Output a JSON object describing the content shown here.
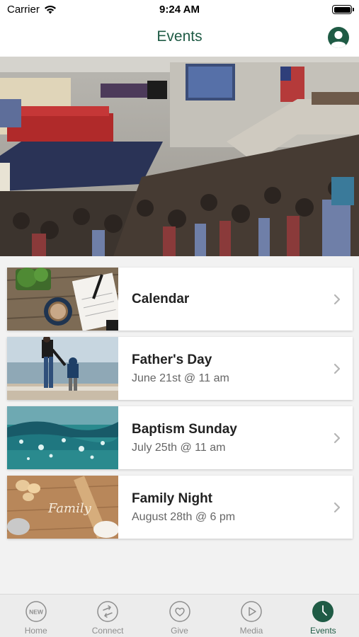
{
  "status_bar": {
    "carrier": "Carrier",
    "time": "9:24 AM",
    "wifi_icon": "wifi-icon",
    "battery_icon": "battery-icon"
  },
  "nav": {
    "title": "Events",
    "profile_icon": "user-profile-icon"
  },
  "hero": {
    "image": "church-congregation-photo"
  },
  "events": [
    {
      "title": "Calendar",
      "subtitle": "",
      "thumb": "notebook-coffee-photo"
    },
    {
      "title": "Father's Day",
      "subtitle": "June 21st @ 11 am",
      "thumb": "father-child-beach-photo"
    },
    {
      "title": "Baptism Sunday",
      "subtitle": "July 25th @ 11 am",
      "thumb": "ocean-wave-photo"
    },
    {
      "title": "Family Night",
      "subtitle": "August 28th @ 6 pm",
      "thumb": "family-baking-photo"
    }
  ],
  "tabs": [
    {
      "label": "Home",
      "icon": "new-badge-icon",
      "badge": "NEW"
    },
    {
      "label": "Connect",
      "icon": "connect-arrows-icon"
    },
    {
      "label": "Give",
      "icon": "heart-icon"
    },
    {
      "label": "Media",
      "icon": "play-icon"
    },
    {
      "label": "Events",
      "icon": "clock-icon",
      "active": true
    }
  ],
  "colors": {
    "accent": "#1f5b45",
    "tab_inactive": "#8e8e8e",
    "background": "#f2f2f2"
  }
}
